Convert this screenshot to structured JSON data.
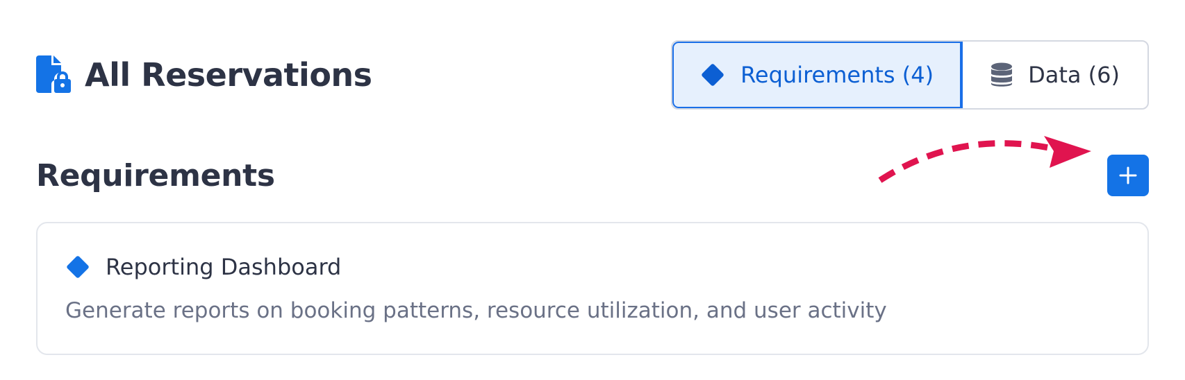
{
  "header": {
    "title": "All Reservations",
    "title_icon": "file-lock-icon"
  },
  "tabs": [
    {
      "label": "Requirements (4)",
      "icon": "diamond-icon",
      "active": true
    },
    {
      "label": "Data (6)",
      "icon": "database-icon",
      "active": false
    }
  ],
  "section": {
    "title": "Requirements",
    "add_icon": "plus-icon"
  },
  "requirements": [
    {
      "title": "Reporting Dashboard",
      "description": "Generate reports on booking patterns, resource utilization, and user activity",
      "icon": "diamond-icon"
    }
  ],
  "colors": {
    "accent": "#1473e6",
    "annotation_arrow": "#e0144f",
    "active_tab_bg": "#e6f0fd",
    "text_primary": "#2d3345",
    "text_secondary": "#6a7186"
  }
}
